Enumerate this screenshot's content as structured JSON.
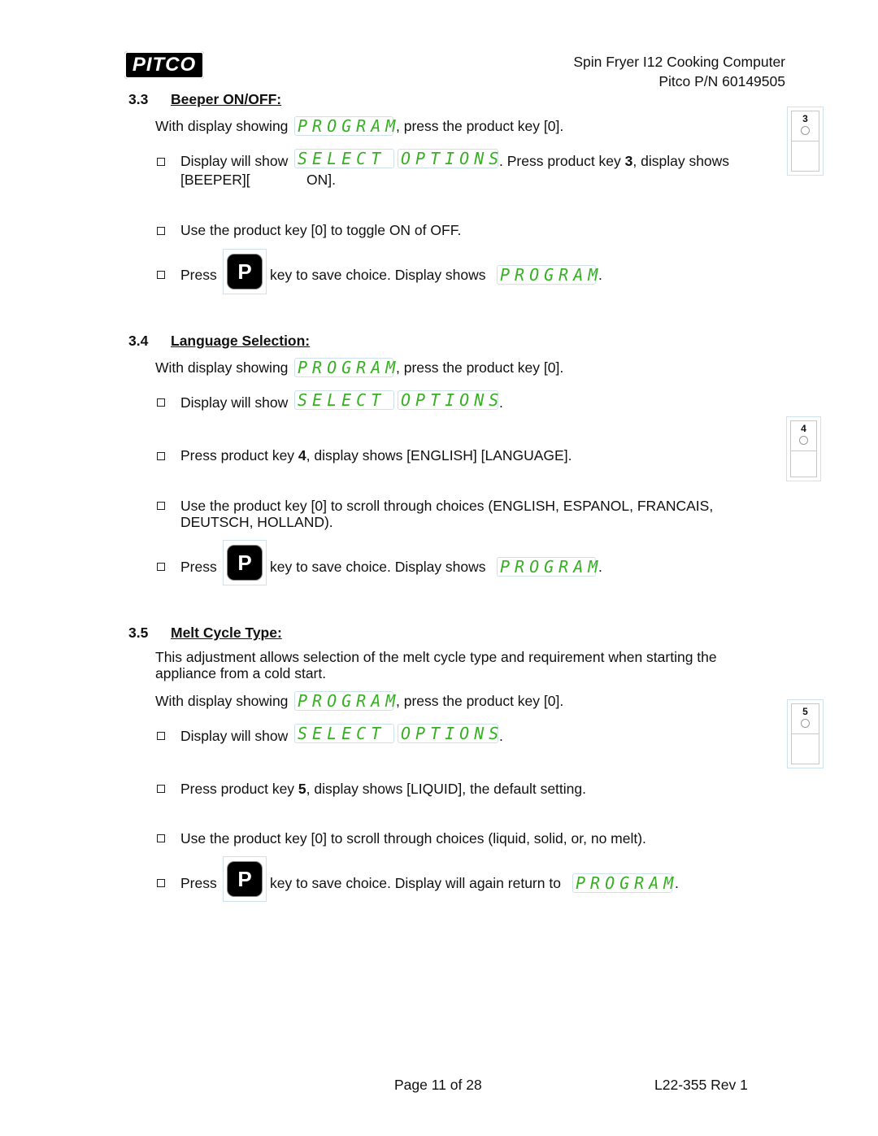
{
  "header": {
    "logo_text": "PITCO",
    "title_line1": "Spin Fryer I12 Cooking Computer",
    "title_line2": "Pitco P/N 60149505"
  },
  "lcd": {
    "program": "PROGRAM",
    "select": "SELECT",
    "options": "OPTIONS",
    "color": "#37b024"
  },
  "p_key_label": "P",
  "sections": [
    {
      "number": "3.3",
      "title": "Beeper ON/OFF:",
      "intro_prefix": "With display showing",
      "intro_suffix": ", press the product key [0].",
      "bullet1_prefix": "Display will show",
      "bullet1_mid": ".  Press product key ",
      "bullet1_key": "3",
      "bullet1_suffix": ", display shows",
      "bullet1_line2a": "[BEEPER][",
      "bullet1_line2b": "ON].",
      "bullet2": "Use the product key [0] to toggle ON of OFF.",
      "press_label": "Press",
      "press_suffix": "key to save choice.  Display shows",
      "press_end": ".",
      "keycard_number": "3"
    },
    {
      "number": "3.4",
      "title": "Language Selection:",
      "intro_prefix": "With display showing",
      "intro_suffix": ", press the product key [0].",
      "bullet1_prefix": "Display will show",
      "bullet1_end": ".",
      "bullet2_prefix": "Press product key ",
      "bullet2_key": "4",
      "bullet2_suffix": ", display shows [ENGLISH] [LANGUAGE].",
      "bullet3_line1": "Use the product key [0] to scroll through choices (ENGLISH, ESPANOL, FRANCAIS,",
      "bullet3_line2": "DEUTSCH, HOLLAND).",
      "press_label": "Press",
      "press_suffix": "key to save choice.  Display shows",
      "press_end": ".",
      "keycard_number": "4"
    },
    {
      "number": "3.5",
      "title": "Melt Cycle Type:",
      "desc_line1": "This adjustment allows selection of the melt cycle type and requirement when starting the",
      "desc_line2": "appliance from a cold start.",
      "intro_prefix": "With display showing",
      "intro_suffix": ", press the product key [0].",
      "bullet1_prefix": "Display will show",
      "bullet1_end": ".",
      "bullet2_prefix": "Press product key ",
      "bullet2_key": "5",
      "bullet2_suffix": ", display shows [LIQUID], the default setting.",
      "bullet3": "Use the product key [0] to scroll through choices (liquid, solid, or,  no melt).",
      "press_label": "Press",
      "press_suffix": "key to save choice.  Display will again return to",
      "press_end": ".",
      "keycard_number": "5"
    }
  ],
  "footer": {
    "page": "Page 11 of 28",
    "doc_id": "L22-355 Rev 1"
  }
}
